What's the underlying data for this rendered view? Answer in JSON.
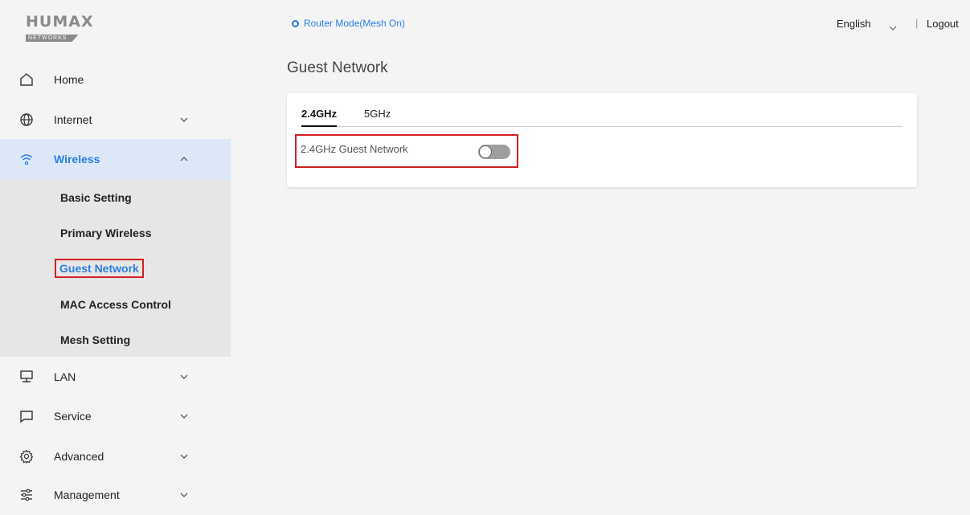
{
  "brand": {
    "logo": "HUMAX",
    "logo_sub": "NETWORKS"
  },
  "header": {
    "mode": "Router Mode(Mesh On)",
    "language": "English",
    "divider": "|",
    "logout": "Logout"
  },
  "sidebar": {
    "items": [
      {
        "label": "Home",
        "icon": "home-icon"
      },
      {
        "label": "Internet",
        "icon": "globe-icon"
      },
      {
        "label": "Wireless",
        "icon": "wifi-icon",
        "expanded": true
      },
      {
        "label": "LAN",
        "icon": "monitor-icon"
      },
      {
        "label": "Service",
        "icon": "chat-icon"
      },
      {
        "label": "Advanced",
        "icon": "gear-icon"
      },
      {
        "label": "Management",
        "icon": "sliders-icon"
      }
    ],
    "wireless_submenu": [
      "Basic Setting",
      "Primary Wireless",
      "Guest Network",
      "MAC Access Control",
      "Mesh Setting"
    ]
  },
  "main": {
    "title": "Guest Network",
    "tabs": [
      "2.4GHz",
      "5GHz"
    ],
    "active_tab": "2.4GHz",
    "setting_label": "2.4GHz Guest Network",
    "toggle_on": false
  },
  "colors": {
    "accent": "#2a7de1",
    "highlight_border": "#d0201f",
    "active_bg": "#dce8f7"
  }
}
